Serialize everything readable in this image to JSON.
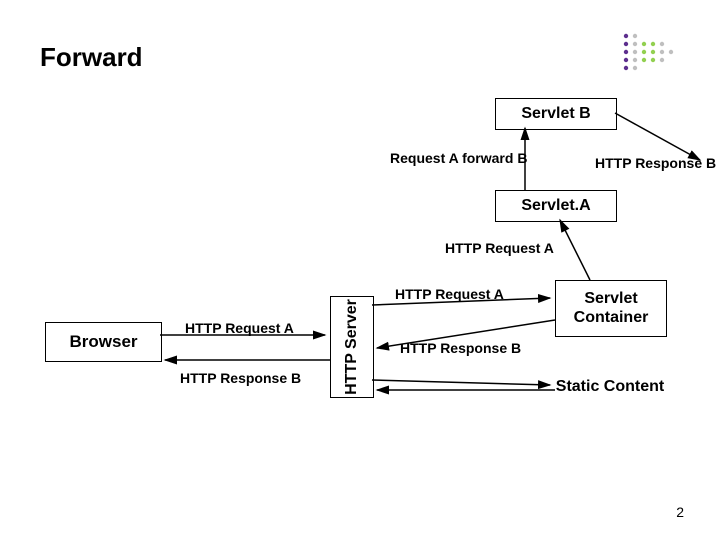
{
  "title": "Forward",
  "boxes": {
    "servletB": "Servlet B",
    "servletA": "Servlet.A",
    "browser": "Browser",
    "httpServer": "HTTP Server",
    "servletContainer": "Servlet Container",
    "staticContent": "Static Content"
  },
  "labels": {
    "requestAForwardB": "Request A forward B",
    "httpResponseB_topRight": "HTTP Response B",
    "httpRequestA_top": "HTTP Request A",
    "httpRequestA_midTop": "HTTP Request A",
    "httpRequestA_browser": "HTTP Request A",
    "httpResponseB_midRight": "HTTP Response B",
    "httpResponseB_browser": "HTTP Response B"
  },
  "page": "2",
  "colors": {
    "lime": "#92d050",
    "purple": "#5d2f8e",
    "gray": "#bfbfbf"
  }
}
